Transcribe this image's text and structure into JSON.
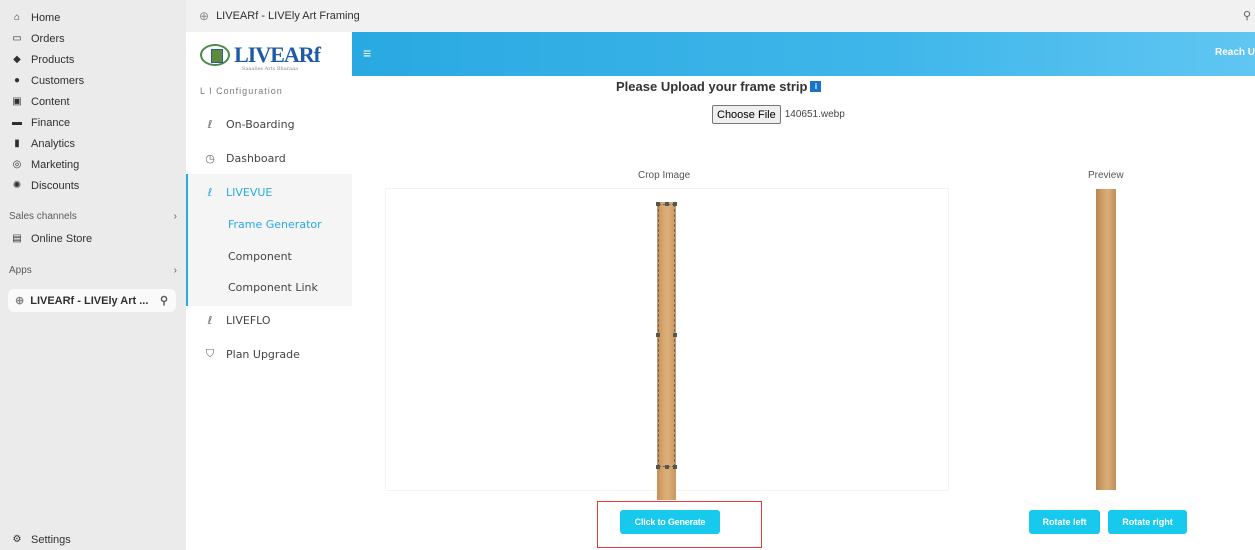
{
  "admin_nav": {
    "items": [
      {
        "label": "Home",
        "icon": "home-icon",
        "glyph": "⌂"
      },
      {
        "label": "Orders",
        "icon": "orders-icon",
        "glyph": "▭"
      },
      {
        "label": "Products",
        "icon": "products-icon",
        "glyph": "◆"
      },
      {
        "label": "Customers",
        "icon": "customers-icon",
        "glyph": "●"
      },
      {
        "label": "Content",
        "icon": "content-icon",
        "glyph": "▣"
      },
      {
        "label": "Finance",
        "icon": "finance-icon",
        "glyph": "▬"
      },
      {
        "label": "Analytics",
        "icon": "analytics-icon",
        "glyph": "▮"
      },
      {
        "label": "Marketing",
        "icon": "marketing-icon",
        "glyph": "◎"
      },
      {
        "label": "Discounts",
        "icon": "discounts-icon",
        "glyph": "✺"
      }
    ],
    "sales_channels_label": "Sales channels",
    "online_store_label": "Online Store",
    "apps_label": "Apps",
    "active_app_label": "LIVEARf - LIVEly Art ...",
    "settings_label": "Settings"
  },
  "title_bar": {
    "app_title": "LIVEARf - LIVEly Art Framing"
  },
  "app_sidebar": {
    "logo_text": "LIVEARf",
    "logo_sub": "Saaalies Arts Bharaaa",
    "config_label": "L I Configuration",
    "menu": [
      {
        "label": "On-Boarding"
      },
      {
        "label": "Dashboard"
      },
      {
        "label": "LIVEVUE"
      },
      {
        "label": "LIVEFLO"
      },
      {
        "label": "Plan Upgrade"
      }
    ],
    "submenu": [
      {
        "label": "Frame Generator"
      },
      {
        "label": "Component"
      },
      {
        "label": "Component Link"
      }
    ]
  },
  "top_bar": {
    "menu_glyph": "≡",
    "reach_label": "Reach U"
  },
  "main": {
    "upload_title": "Please Upload your frame strip",
    "info_badge": "i",
    "choose_file_label": "Choose File",
    "file_name": "140651.webp",
    "crop_label": "Crop Image",
    "preview_label": "Preview",
    "generate_label": "Click to Generate",
    "rotate_left_label": "Rotate left",
    "rotate_right_label": "Rotate right"
  },
  "colors": {
    "accent": "#29a9e1",
    "button": "#18c9ee",
    "highlight": "#e53935",
    "wood": "#d4a46c"
  }
}
